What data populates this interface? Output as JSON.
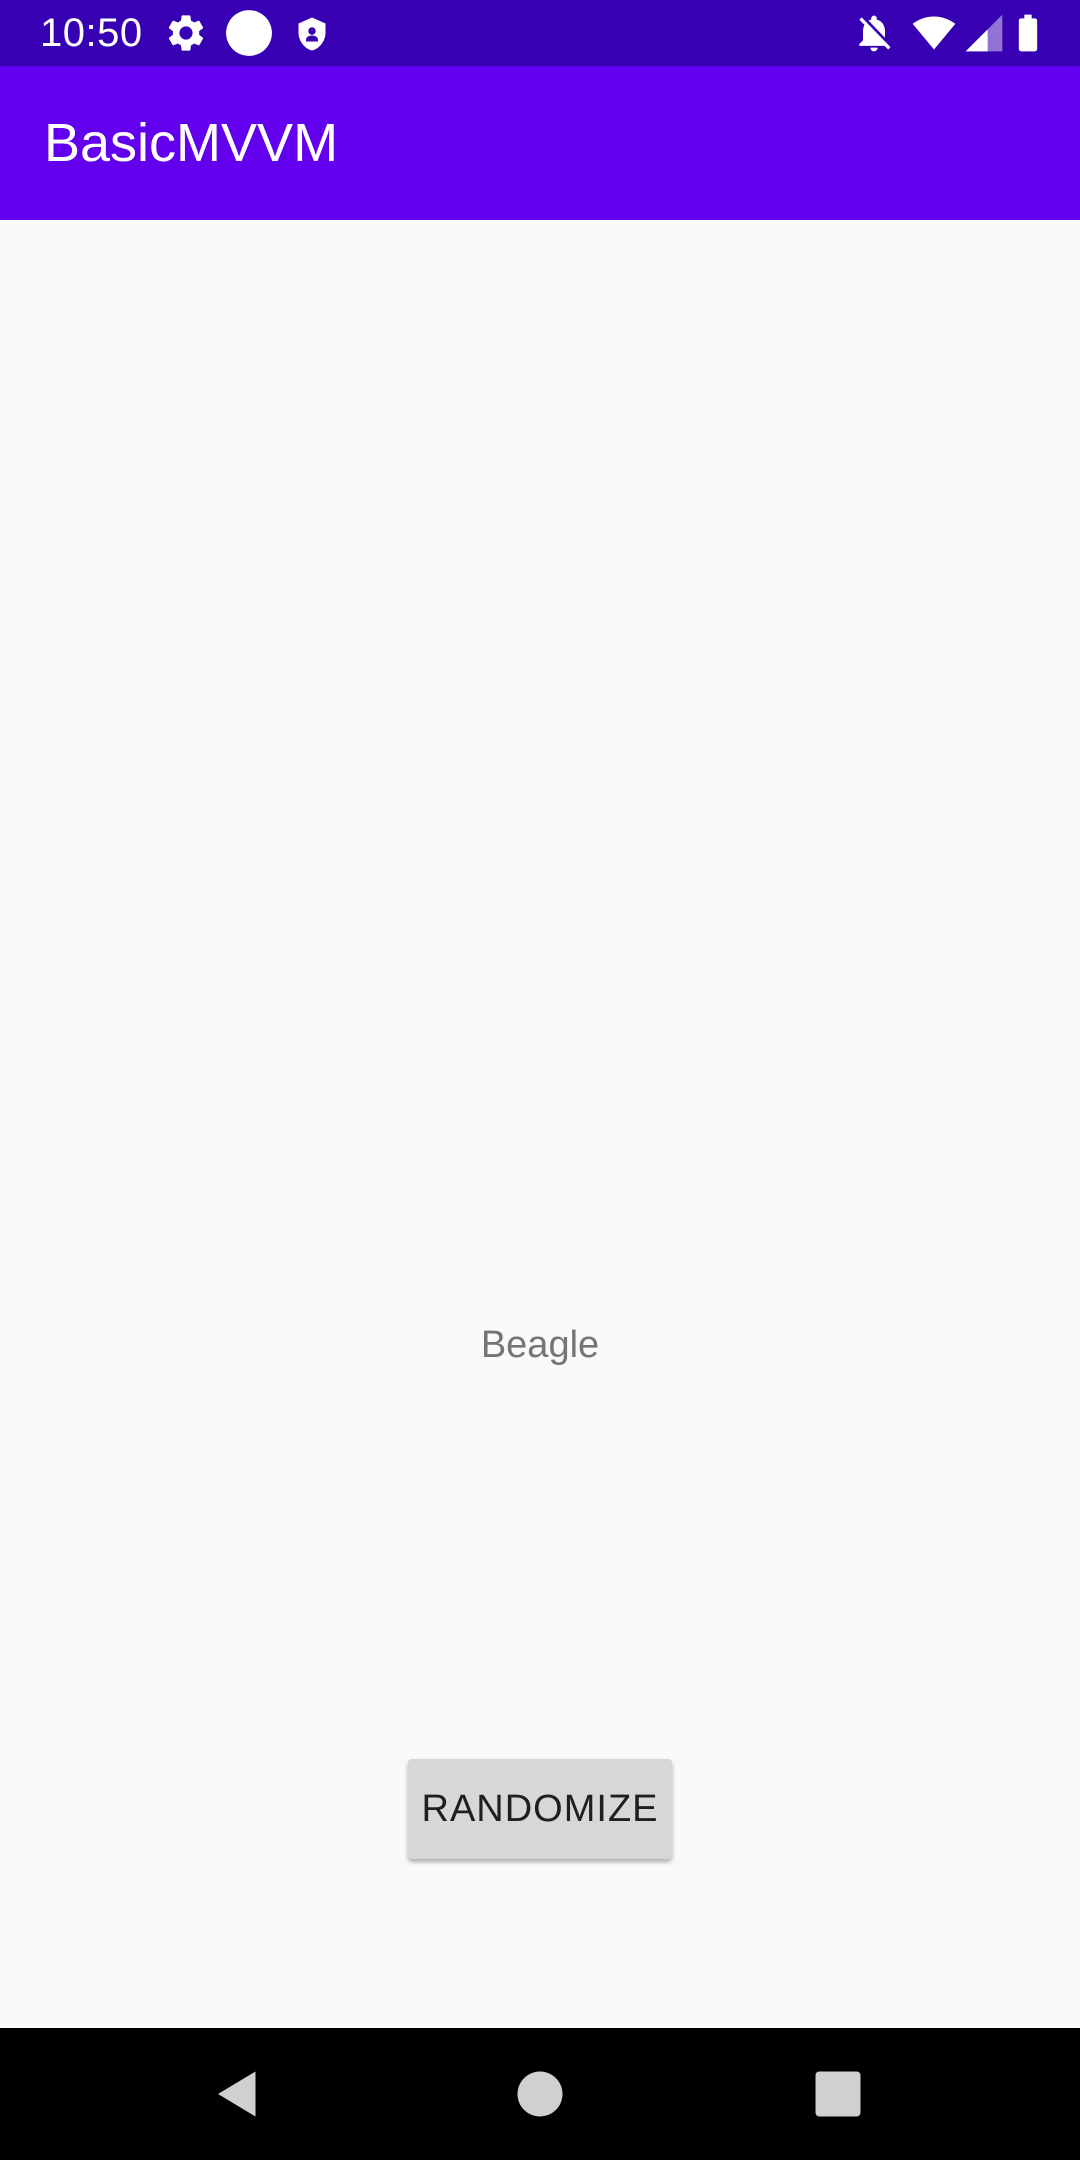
{
  "status_bar": {
    "time": "10:50",
    "background_color": "#3700b3",
    "left_icons": [
      "gear-icon",
      "circle-icon",
      "shield-icon"
    ],
    "right_icons": [
      "notifications-off-icon",
      "wifi-icon",
      "cell-signal-icon",
      "battery-icon"
    ]
  },
  "app_bar": {
    "title": "BasicMVVM",
    "background_color": "#6200ee"
  },
  "main": {
    "breed_text": "Beagle",
    "randomize_label": "RANDOMIZE"
  },
  "nav_bar": {
    "buttons": [
      "back-icon",
      "home-icon",
      "recents-icon"
    ]
  }
}
